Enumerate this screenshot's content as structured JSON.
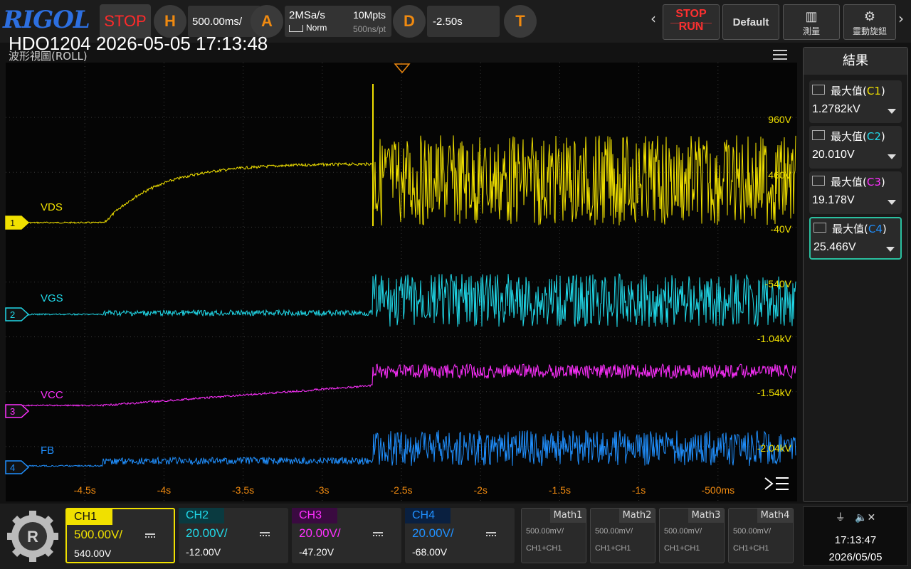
{
  "brand": "RIGOL",
  "top": {
    "run_state": "STOP",
    "h_label": "H",
    "timebase": "500.00ms/",
    "a_label": "A",
    "sample_rate": "2MSa/s",
    "mem_depth": "10Mpts",
    "trig_mode": "Norm",
    "time_per_pt": "500ns/pt",
    "d_label": "D",
    "delay": "-2.50s",
    "t_label": "T",
    "stop_label": "STOP",
    "run_label": "RUN",
    "default_label": "Default",
    "measure_label": "測量",
    "knob_label": "靈動旋鈕"
  },
  "header": {
    "device_title": "HDO1204 2026-05-05 17:13:48",
    "view_title": "波形視圖(ROLL)"
  },
  "colors": {
    "ch1": "#f0e000",
    "ch2": "#20d8e8",
    "ch3": "#ff30ff",
    "ch4": "#2090ff",
    "select": "#2ac0a0"
  },
  "channels": [
    {
      "num": "1",
      "name": "VDS",
      "tab": "CH1",
      "scale": "500.00V/",
      "offset": "540.00V"
    },
    {
      "num": "2",
      "name": "VGS",
      "tab": "CH2",
      "scale": "20.00V/",
      "offset": "-12.00V"
    },
    {
      "num": "3",
      "name": "VCC",
      "tab": "CH3",
      "scale": "20.00V/",
      "offset": "-47.20V"
    },
    {
      "num": "4",
      "name": "FB",
      "tab": "CH4",
      "scale": "20.00V/",
      "offset": "-68.00V"
    }
  ],
  "right_scale": [
    "960V",
    "460V",
    "-40V",
    "-540V",
    "-1.04kV",
    "-1.54kV",
    "-2.04kV"
  ],
  "time_ticks": [
    "-4.5s",
    "-4s",
    "-3.5s",
    "-3s",
    "-2.5s",
    "-2s",
    "-1.5s",
    "-1s",
    "-500ms"
  ],
  "results": {
    "title": "結果",
    "items": [
      {
        "label": "最大值",
        "src": "C1",
        "value": "1.2782kV"
      },
      {
        "label": "最大值",
        "src": "C2",
        "value": "20.010V"
      },
      {
        "label": "最大值",
        "src": "C3",
        "value": "19.178V"
      },
      {
        "label": "最大值",
        "src": "C4",
        "value": "25.466V"
      }
    ]
  },
  "math": [
    {
      "title": "Math1",
      "scale": "500.00mV/",
      "formula": "CH1+CH1"
    },
    {
      "title": "Math2",
      "scale": "500.00mV/",
      "formula": "CH1+CH1"
    },
    {
      "title": "Math3",
      "scale": "500.00mV/",
      "formula": "CH1+CH1"
    },
    {
      "title": "Math4",
      "scale": "500.00mV/",
      "formula": "CH1+CH1"
    }
  ],
  "clock": {
    "time": "17:13:47",
    "date": "2026/05/05"
  }
}
